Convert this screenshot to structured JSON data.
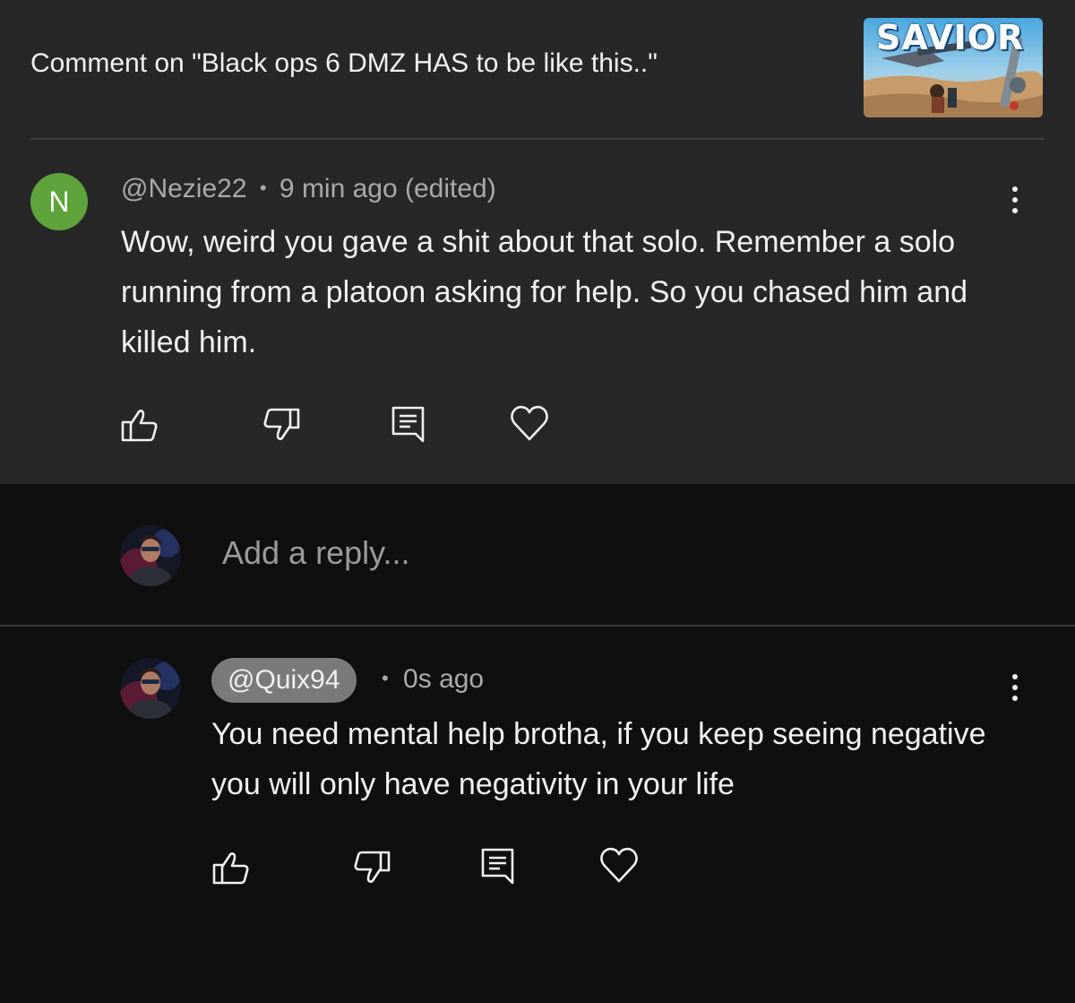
{
  "header": {
    "title": "Comment on \"Black ops 6 DMZ HAS to be like this..\"",
    "thumbnail_text": "SAVIOR"
  },
  "comment": {
    "avatar_letter": "N",
    "handle": "@Nezie22",
    "separator": "•",
    "time": "9 min ago (edited)",
    "text": "Wow, weird you gave a shit about that solo. Remember a solo running from a platoon asking for help. So you chased him and killed him.",
    "actions": [
      "thumbs-up-icon",
      "thumbs-down-icon",
      "reply-icon",
      "heart-icon"
    ]
  },
  "reply_box": {
    "placeholder": "Add a reply..."
  },
  "reply": {
    "handle": "@Quix94",
    "separator": "•",
    "time": "0s ago",
    "text": "You need mental help brotha, if you keep seeing negative you will only have negativity in your life",
    "actions": [
      "thumbs-up-icon",
      "thumbs-down-icon",
      "reply-icon",
      "heart-icon"
    ]
  },
  "colors": {
    "header_bg": "#272727",
    "page_bg": "#0f0f0f",
    "avatar_green": "#5fa33c",
    "handle_pill": "#7a7a7a"
  }
}
